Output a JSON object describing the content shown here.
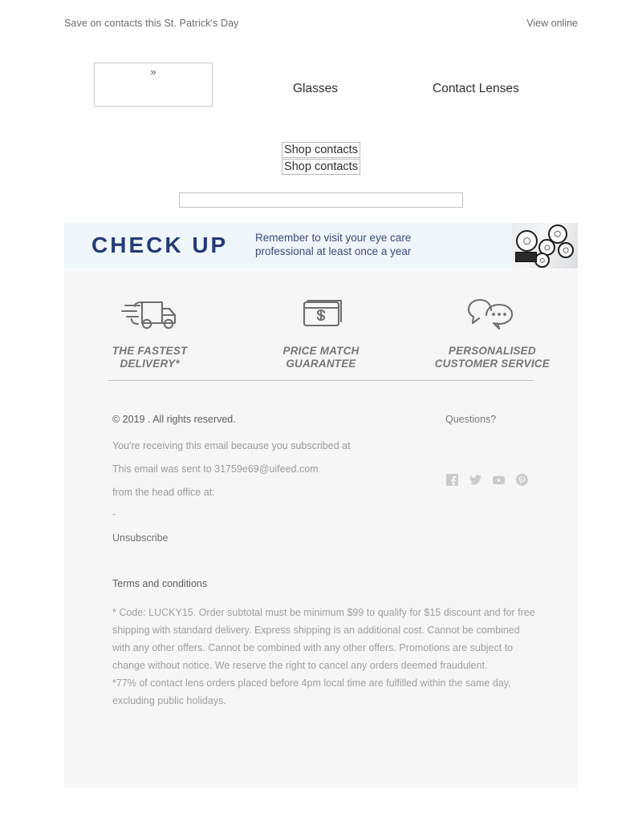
{
  "preheader": {
    "text": "Save on contacts this St. Patrick's Day",
    "view_online": "View online"
  },
  "header": {
    "logo_glyph": "»",
    "nav": [
      {
        "label": "Glasses",
        "name": "nav-link-glasses"
      },
      {
        "label": "Contact Lenses",
        "name": "nav-link-contact-lenses"
      }
    ]
  },
  "hero": {
    "cta_primary": "Shop contacts",
    "cta_secondary": "Shop contacts"
  },
  "checkup": {
    "title": "CHECK UP",
    "subtitle_line1": "Remember to visit your eye care",
    "subtitle_line2": "professional at least once a year",
    "title_color": "#253b74",
    "background": "#eef6fa"
  },
  "features": [
    {
      "icon": "delivery-truck-icon",
      "label_line1": "THE FASTEST",
      "label_line2": "DELIVERY*"
    },
    {
      "icon": "price-tag-cards-icon",
      "label_line1": "PRICE MATCH",
      "label_line2": "GUARANTEE"
    },
    {
      "icon": "speech-bubbles-icon",
      "label_line1": "PERSONALISED",
      "label_line2": "CUSTOMER SERVICE"
    }
  ],
  "footer": {
    "copyright": "© 2019 . All rights reserved.",
    "line_subscribed": "You're receiving this email because you subscribed at",
    "line_sent_to": "This email was sent to 31759e69@uifeed.com",
    "line_head_office": "from the head office at:",
    "line_address": "-",
    "unsubscribe": "Unsubscribe",
    "questions": "Questions?",
    "social": [
      {
        "name": "facebook-icon",
        "label": "Facebook"
      },
      {
        "name": "twitter-icon",
        "label": "Twitter"
      },
      {
        "name": "youtube-icon",
        "label": "YouTube"
      },
      {
        "name": "pinterest-icon",
        "label": "Pinterest"
      }
    ]
  },
  "terms": {
    "title": "Terms and conditions",
    "paragraph1": "* Code: LUCKY15. Order subtotal must be minimum $99 to qualify for $15 discount and for free shipping with standard delivery. Express shipping is an additional cost. Cannot be combined with any other offers. Cannot be combined with any other offers. Promotions are subject to change without notice. We reserve the right to cancel any orders deemed fraudulent.",
    "paragraph2": "*77% of contact lens orders placed before 4pm local time are fulfilled within the same day, excluding public holidays."
  }
}
